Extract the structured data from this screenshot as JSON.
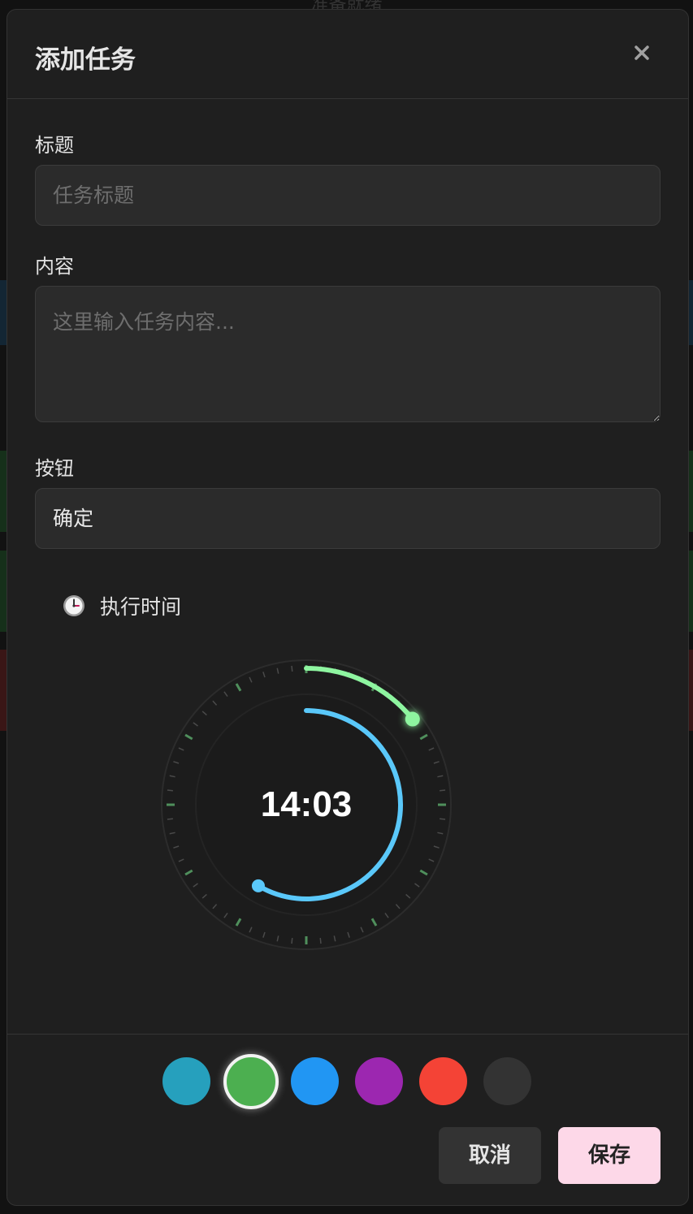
{
  "background": {
    "title": "准备就绪"
  },
  "modal": {
    "title": "添加任务",
    "close_icon": "close-icon"
  },
  "form": {
    "title_label": "标题",
    "title_placeholder": "任务标题",
    "title_value": "",
    "content_label": "内容",
    "content_placeholder": "这里输入任务内容...",
    "content_value": "",
    "button_label": "按钮",
    "button_value": "确定"
  },
  "time": {
    "icon": "clock-icon",
    "label": "执行时间",
    "value": "14:03",
    "hour_fraction": 0.585,
    "minute_fraction": 0.05
  },
  "colors": {
    "swatches": [
      "#26a0bd",
      "#4caf50",
      "#2196f3",
      "#9c27b0",
      "#f44336",
      "#333333"
    ],
    "selected_index": 1,
    "hour_arc": "#5ac8fa",
    "minute_arc": "#8ef5a0",
    "tick": "#4a4a4a",
    "major_tick": "#4f8f5c"
  },
  "actions": {
    "cancel": "取消",
    "save": "保存"
  }
}
